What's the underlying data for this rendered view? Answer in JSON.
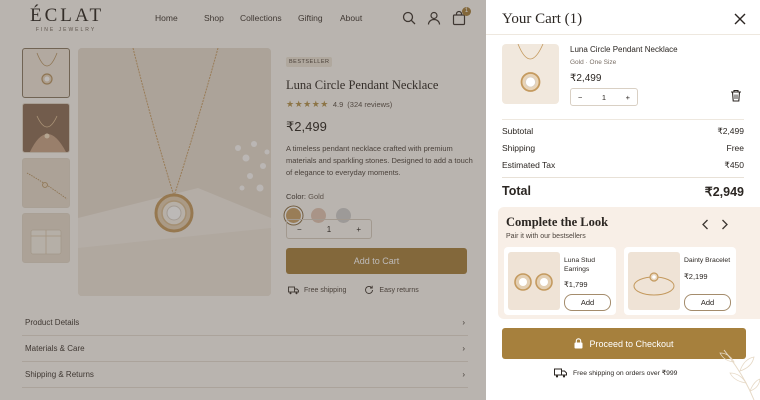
{
  "header": {
    "logo": "ÉCLAT",
    "logo_sub": "FINE JEWELRY",
    "nav": [
      "Home",
      "Shop",
      "Collections",
      "Gifting",
      "About"
    ],
    "cart_count": "1"
  },
  "product": {
    "badge": "BESTSELLER",
    "title": "Luna Circle Pendant Necklace",
    "rating": "4.9",
    "reviews": "(324 reviews)",
    "price": "₹2,499",
    "description": "A timeless pendant necklace crafted with premium materials and sparkling stones. Designed to add a touch of elegance to everyday moments.",
    "color_label": "Color:",
    "color_value": "Gold",
    "swatches": [
      "#c9a26a",
      "#e2c6b5",
      "#cfcfcf"
    ],
    "quantity": "1",
    "add_to_cart": "Add to Cart",
    "perks": [
      "Free shipping",
      "Easy returns"
    ]
  },
  "accordion": [
    "Product Details",
    "Materials & Care",
    "Shipping & Returns"
  ],
  "cart": {
    "title": "Your Cart (1)",
    "item": {
      "name": "Luna Circle Pendant Necklace",
      "variant": "Gold",
      "size": "One Size",
      "price": "₹2,499",
      "quantity": "1"
    },
    "summary": {
      "subtotal_label": "Subtotal",
      "subtotal": "₹2,499",
      "shipping_label": "Shipping",
      "shipping": "Free",
      "tax_label": "Estimated Tax",
      "tax": "₹450",
      "total_label": "Total",
      "total": "₹2,949"
    },
    "complete_look": {
      "title": "Complete the Look",
      "subtitle": "Pair it with our bestsellers",
      "products": [
        {
          "name": "Luna Stud Earrings",
          "price": "₹1,799",
          "add": "Add"
        },
        {
          "name": "Dainty Bracelet",
          "price": "₹2,199",
          "add": "Add"
        }
      ]
    },
    "checkout": "Proceed to Checkout",
    "shipping_note": "Free shipping on orders over ₹999"
  },
  "colors": {
    "accent": "#a6803d",
    "background": "#fbf8f3",
    "panel": "#f8efe7"
  }
}
